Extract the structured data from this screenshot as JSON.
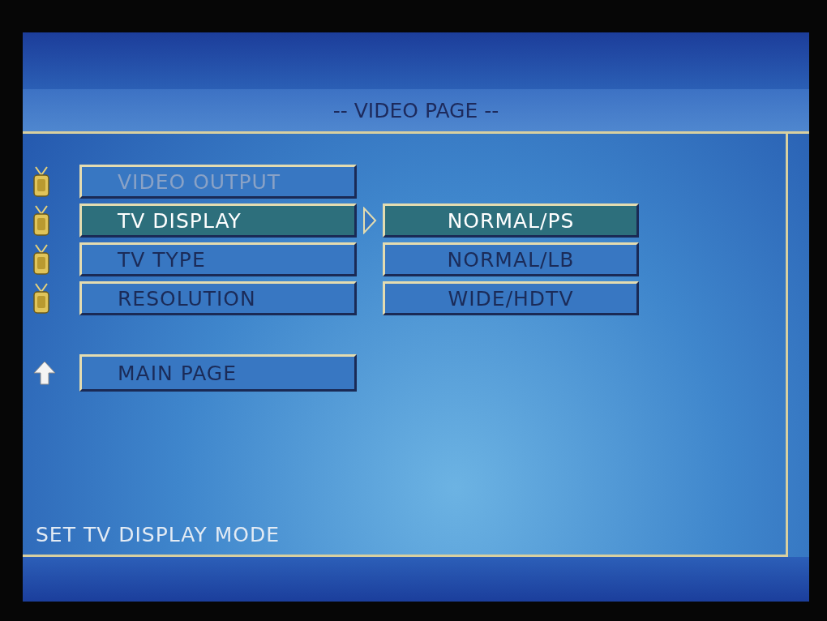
{
  "title": "-- VIDEO PAGE --",
  "menu": [
    {
      "label": "VIDEO OUTPUT",
      "selected": false,
      "disabled": true
    },
    {
      "label": "TV DISPLAY",
      "selected": true,
      "disabled": false
    },
    {
      "label": "TV TYPE",
      "selected": false,
      "disabled": false
    },
    {
      "label": "RESOLUTION",
      "selected": false,
      "disabled": false
    }
  ],
  "submenu": [
    {
      "label": "NORMAL/PS",
      "selected": true
    },
    {
      "label": "NORMAL/LB",
      "selected": false
    },
    {
      "label": "WIDE/HDTV",
      "selected": false
    }
  ],
  "main_page": {
    "label": "MAIN PAGE"
  },
  "status": "SET TV DISPLAY MODE"
}
